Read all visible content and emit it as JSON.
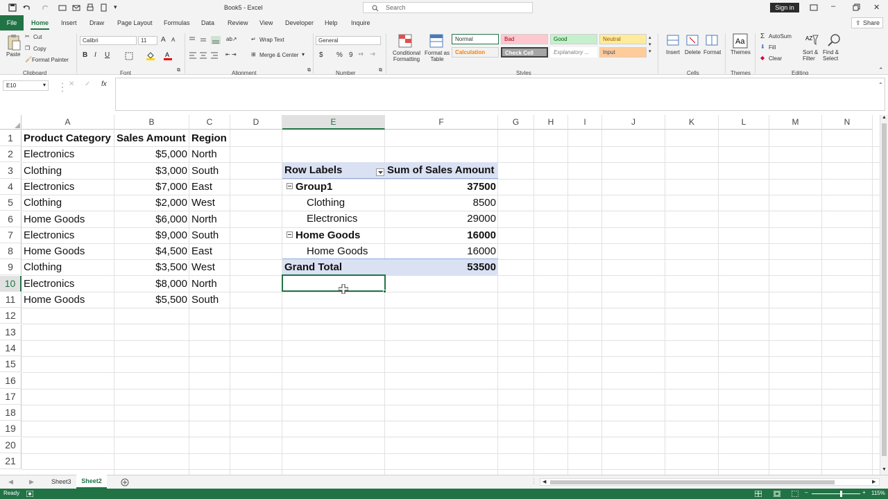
{
  "title": {
    "doc": "Book5 - Excel",
    "search": "Search",
    "signin": "Sign in"
  },
  "tabs": [
    "File",
    "Home",
    "Insert",
    "Draw",
    "Page Layout",
    "Formulas",
    "Data",
    "Review",
    "View",
    "Developer",
    "Help",
    "Inquire"
  ],
  "share": "Share",
  "ribbon": {
    "clipboard": {
      "paste": "Paste",
      "cut": "Cut",
      "copy": "Copy",
      "format_painter": "Format Painter",
      "label": "Clipboard"
    },
    "font": {
      "name": "Calibri",
      "size": "11",
      "label": "Font",
      "bold": "B",
      "italic": "I",
      "underline": "U"
    },
    "alignment": {
      "wrap": "Wrap Text",
      "merge": "Merge & Center",
      "label": "Alignment"
    },
    "number": {
      "format": "General",
      "label": "Number",
      "currency": "$",
      "percent": "%",
      "comma": "9"
    },
    "styles": {
      "conditional": "Conditional Formatting",
      "format_table": "Format as Table",
      "normal": "Normal",
      "bad": "Bad",
      "good": "Good",
      "neutral": "Neutral",
      "calculation": "Calculation",
      "check": "Check Cell",
      "explanatory": "Explanatory ...",
      "input": "Input",
      "label": "Styles"
    },
    "cells": {
      "insert": "Insert",
      "delete": "Delete",
      "format": "Format",
      "label": "Cells"
    },
    "themes": {
      "themes": "Themes",
      "label": "Themes"
    },
    "editing": {
      "autosum": "AutoSum",
      "fill": "Fill",
      "clear": "Clear",
      "sort": "Sort & Filter",
      "find": "Find & Select",
      "label": "Editing"
    }
  },
  "namebox": "E10",
  "formula": "",
  "columns": [
    "A",
    "B",
    "C",
    "D",
    "E",
    "F",
    "G",
    "H",
    "I",
    "J",
    "K",
    "L",
    "M",
    "N"
  ],
  "rows": [
    "1",
    "2",
    "3",
    "4",
    "5",
    "6",
    "7",
    "8",
    "9",
    "10",
    "11",
    "12",
    "13",
    "14",
    "15",
    "16",
    "17",
    "18",
    "19",
    "20",
    "21"
  ],
  "data_table": {
    "headers": [
      "Product Category",
      "Sales Amount",
      "Region"
    ],
    "rows": [
      [
        "Electronics",
        "$5,000",
        "North"
      ],
      [
        "Clothing",
        "$3,000",
        "South"
      ],
      [
        "Electronics",
        "$7,000",
        "East"
      ],
      [
        "Clothing",
        "$2,000",
        "West"
      ],
      [
        "Home Goods",
        "$6,000",
        "North"
      ],
      [
        "Electronics",
        "$9,000",
        "South"
      ],
      [
        "Home Goods",
        "$4,500",
        "East"
      ],
      [
        "Clothing",
        "$3,500",
        "West"
      ],
      [
        "Electronics",
        "$8,000",
        "North"
      ],
      [
        "Home Goods",
        "$5,500",
        "South"
      ]
    ]
  },
  "pivot": {
    "header_label": "Row Labels",
    "header_value": "Sum of Sales Amount",
    "group1": {
      "name": "Group1",
      "total": "37500",
      "items": [
        [
          "Clothing",
          "8500"
        ],
        [
          "Electronics",
          "29000"
        ]
      ]
    },
    "group2": {
      "name": "Home Goods",
      "total": "16000",
      "items": [
        [
          "Home Goods",
          "16000"
        ]
      ]
    },
    "grand_label": "Grand Total",
    "grand_value": "53500"
  },
  "sheets": [
    "Sheet3",
    "Sheet2"
  ],
  "active_sheet": "Sheet2",
  "status": {
    "ready": "Ready",
    "zoom": "115%"
  }
}
